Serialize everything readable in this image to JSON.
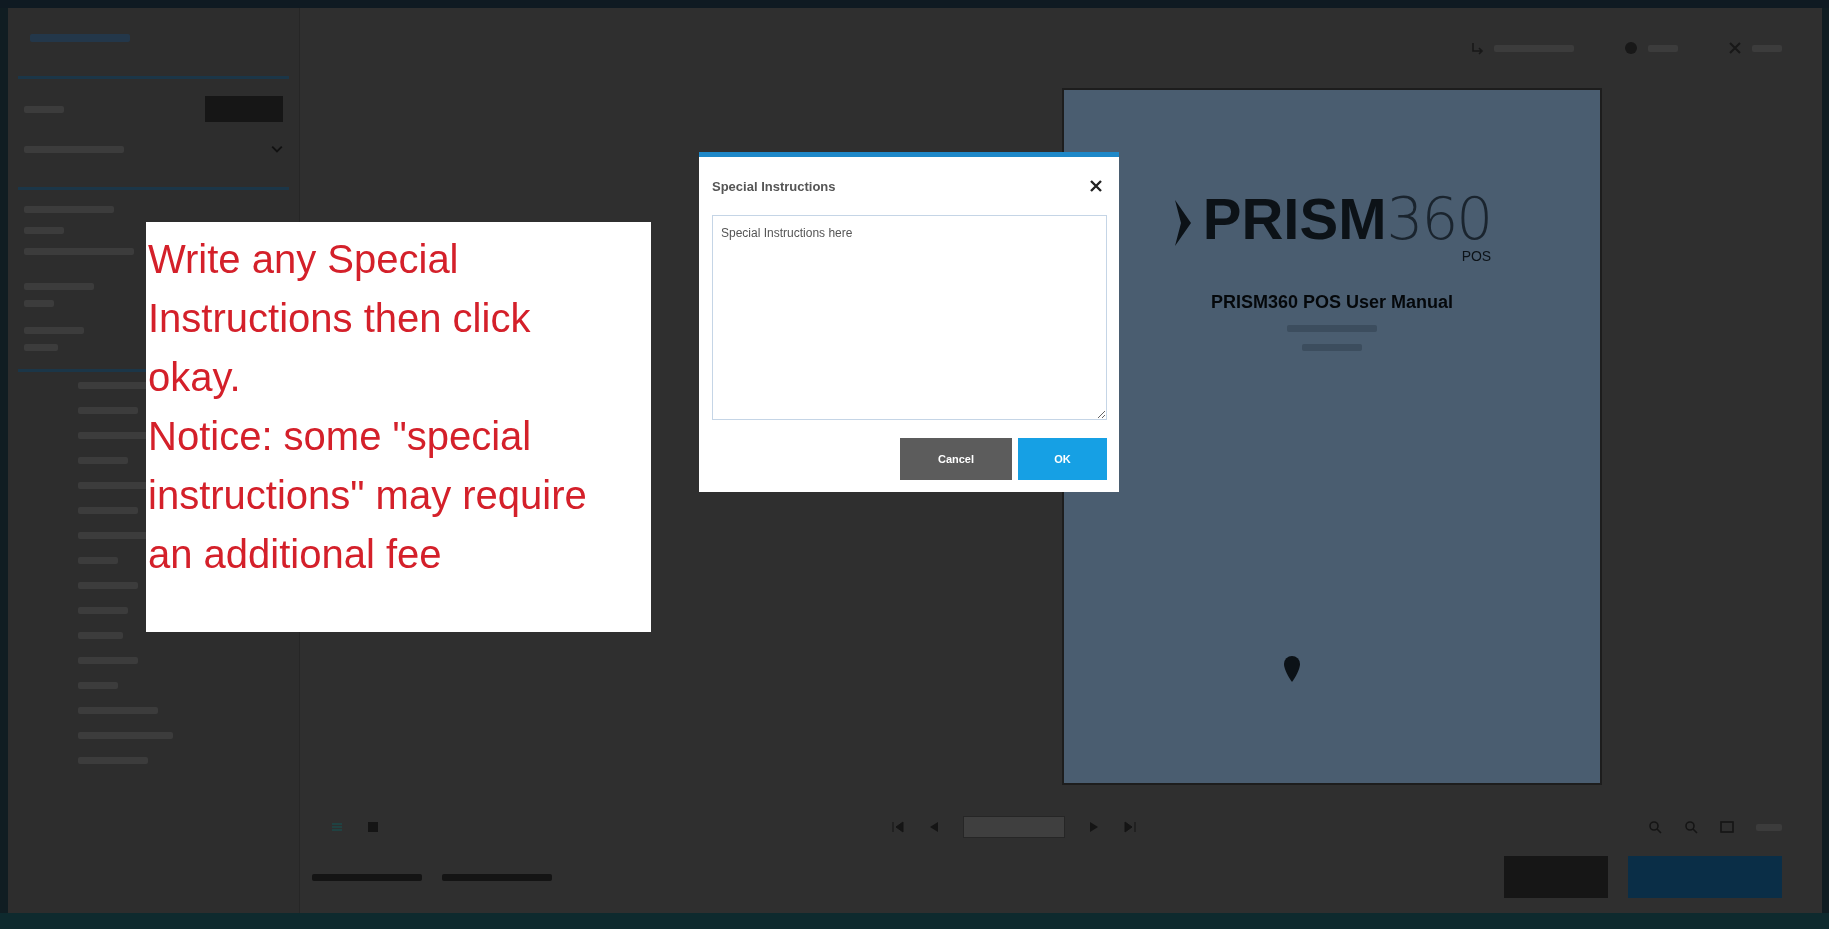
{
  "dialog": {
    "title": "Special Instructions",
    "text": "Special Instructions here",
    "buttons": [
      {
        "label": "Cancel",
        "kind": "secondary"
      },
      {
        "label": "OK",
        "kind": "primary"
      }
    ]
  },
  "callout": {
    "paragraphs": [
      "Write any Special Instructions then click okay.",
      "Notice: some \"special instructions\" may require an additional fee"
    ]
  },
  "document": {
    "logo": {
      "brand": "PRISM",
      "number": "360",
      "product": "POS"
    },
    "title": "PRISM360 POS User Manual"
  }
}
